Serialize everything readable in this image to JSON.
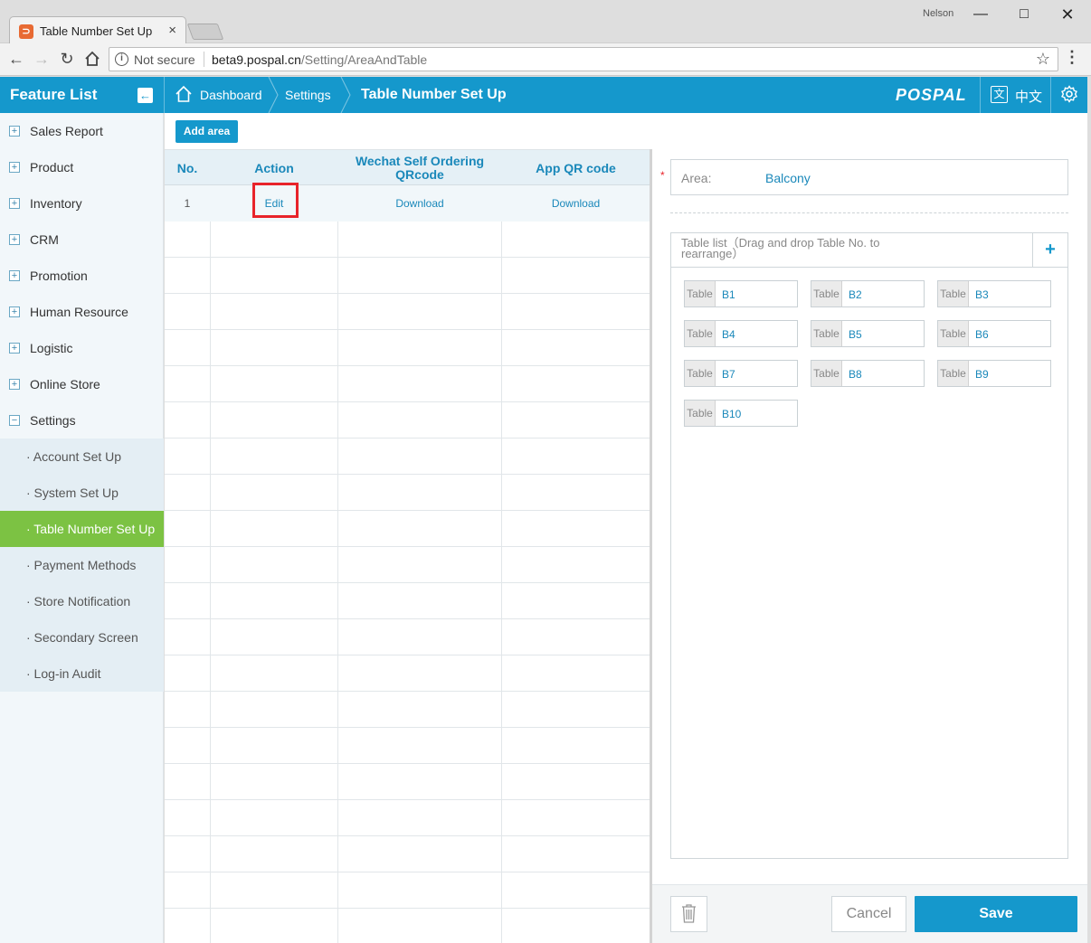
{
  "browser": {
    "tab_title": "Table Number Set Up",
    "tab_close": "×",
    "favicon_glyph": "⊃",
    "profile_name": "Nelson",
    "security_label": "Not secure",
    "url_host": "beta9.pospal.cn",
    "url_path": "/Setting/AreaAndTable"
  },
  "header": {
    "feature_list": "Feature List",
    "breadcrumbs": [
      "Dashboard",
      "Settings",
      "Table Number Set Up"
    ],
    "logo": "POSPAL",
    "lang_icon_glyph": "文",
    "language": "中文",
    "brand_color": "#1598cc"
  },
  "sidebar": {
    "items": [
      {
        "label": "Sales Report",
        "expanded": false
      },
      {
        "label": "Product",
        "expanded": false
      },
      {
        "label": "Inventory",
        "expanded": false
      },
      {
        "label": "CRM",
        "expanded": false
      },
      {
        "label": "Promotion",
        "expanded": false
      },
      {
        "label": "Human Resource",
        "expanded": false
      },
      {
        "label": "Logistic",
        "expanded": false
      },
      {
        "label": "Online Store",
        "expanded": false
      },
      {
        "label": "Settings",
        "expanded": true
      }
    ],
    "plus_glyph": "+",
    "minus_glyph": "−",
    "sub_items": [
      {
        "label": "· Account Set Up",
        "active": false
      },
      {
        "label": "· System Set Up",
        "active": false
      },
      {
        "label": "· Table Number Set Up",
        "active": true
      },
      {
        "label": "· Payment Methods",
        "active": false
      },
      {
        "label": "· Store Notification",
        "active": false
      },
      {
        "label": "· Secondary Screen",
        "active": false
      },
      {
        "label": "· Log-in Audit",
        "active": false
      }
    ],
    "active_color": "#7cc243"
  },
  "toolbar": {
    "add_area": "Add area"
  },
  "area_table": {
    "columns": [
      "No.",
      "Action",
      "Wechat Self Ordering QRcode",
      "App QR code"
    ],
    "rows": [
      {
        "no": "1",
        "action": "Edit",
        "wechat_qr": "Download",
        "app_qr": "Download"
      }
    ]
  },
  "editor": {
    "required_mark": "*",
    "area_label": "Area:",
    "area_value": "Balcony",
    "table_list_title": "Table list（Drag and drop Table No. to rearrange）",
    "add_table": "+",
    "table_prefix": "Table",
    "tables": [
      "B1",
      "B2",
      "B3",
      "B4",
      "B5",
      "B6",
      "B7",
      "B8",
      "B9",
      "B10"
    ],
    "cancel": "Cancel",
    "save": "Save"
  }
}
